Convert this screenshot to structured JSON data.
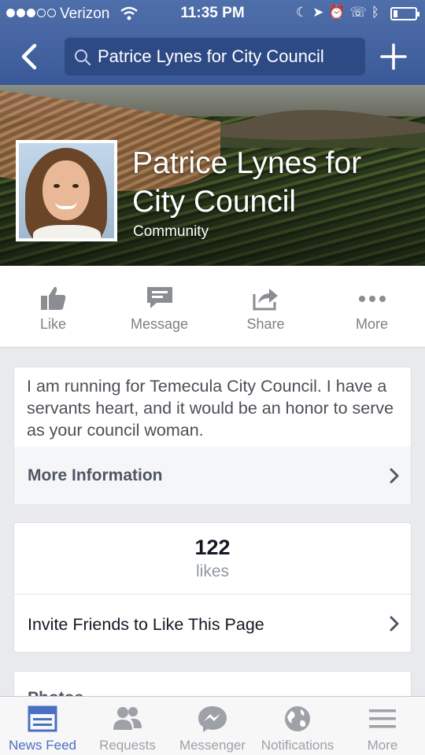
{
  "status_bar": {
    "carrier": "Verizon",
    "time": "11:35 PM",
    "signal_bars_filled": 3,
    "signal_bars_total": 5,
    "battery_level": 0.2
  },
  "nav": {
    "search_text": "Patrice Lynes for City Council",
    "back_icon": "chevron-left-icon",
    "add_icon": "plus-icon"
  },
  "page": {
    "name": "Patrice Lynes for City Council",
    "category": "Community"
  },
  "actions": [
    {
      "label": "Like",
      "icon": "thumbs-up-icon"
    },
    {
      "label": "Message",
      "icon": "message-icon"
    },
    {
      "label": "Share",
      "icon": "share-icon"
    },
    {
      "label": "More",
      "icon": "more-dots-icon"
    }
  ],
  "about": {
    "text": "I am running for Temecula City Council.  I have a servants heart, and it would be an honor to serve as your council woman.",
    "more_info_label": "More Information"
  },
  "likes": {
    "count": "122",
    "label": "likes",
    "invite_label": "Invite Friends to Like This Page"
  },
  "photos": {
    "label": "Photos"
  },
  "tabs": [
    {
      "label": "News Feed",
      "icon": "news-feed-icon",
      "active": true
    },
    {
      "label": "Requests",
      "icon": "friend-requests-icon",
      "active": false
    },
    {
      "label": "Messenger",
      "icon": "messenger-icon",
      "active": false
    },
    {
      "label": "Notifications",
      "icon": "globe-icon",
      "active": false
    },
    {
      "label": "More",
      "icon": "menu-icon",
      "active": false
    }
  ],
  "colors": {
    "brand": "#3b5998",
    "active_tab": "#4a6fc3",
    "inactive_tab": "#9ea1a7"
  }
}
